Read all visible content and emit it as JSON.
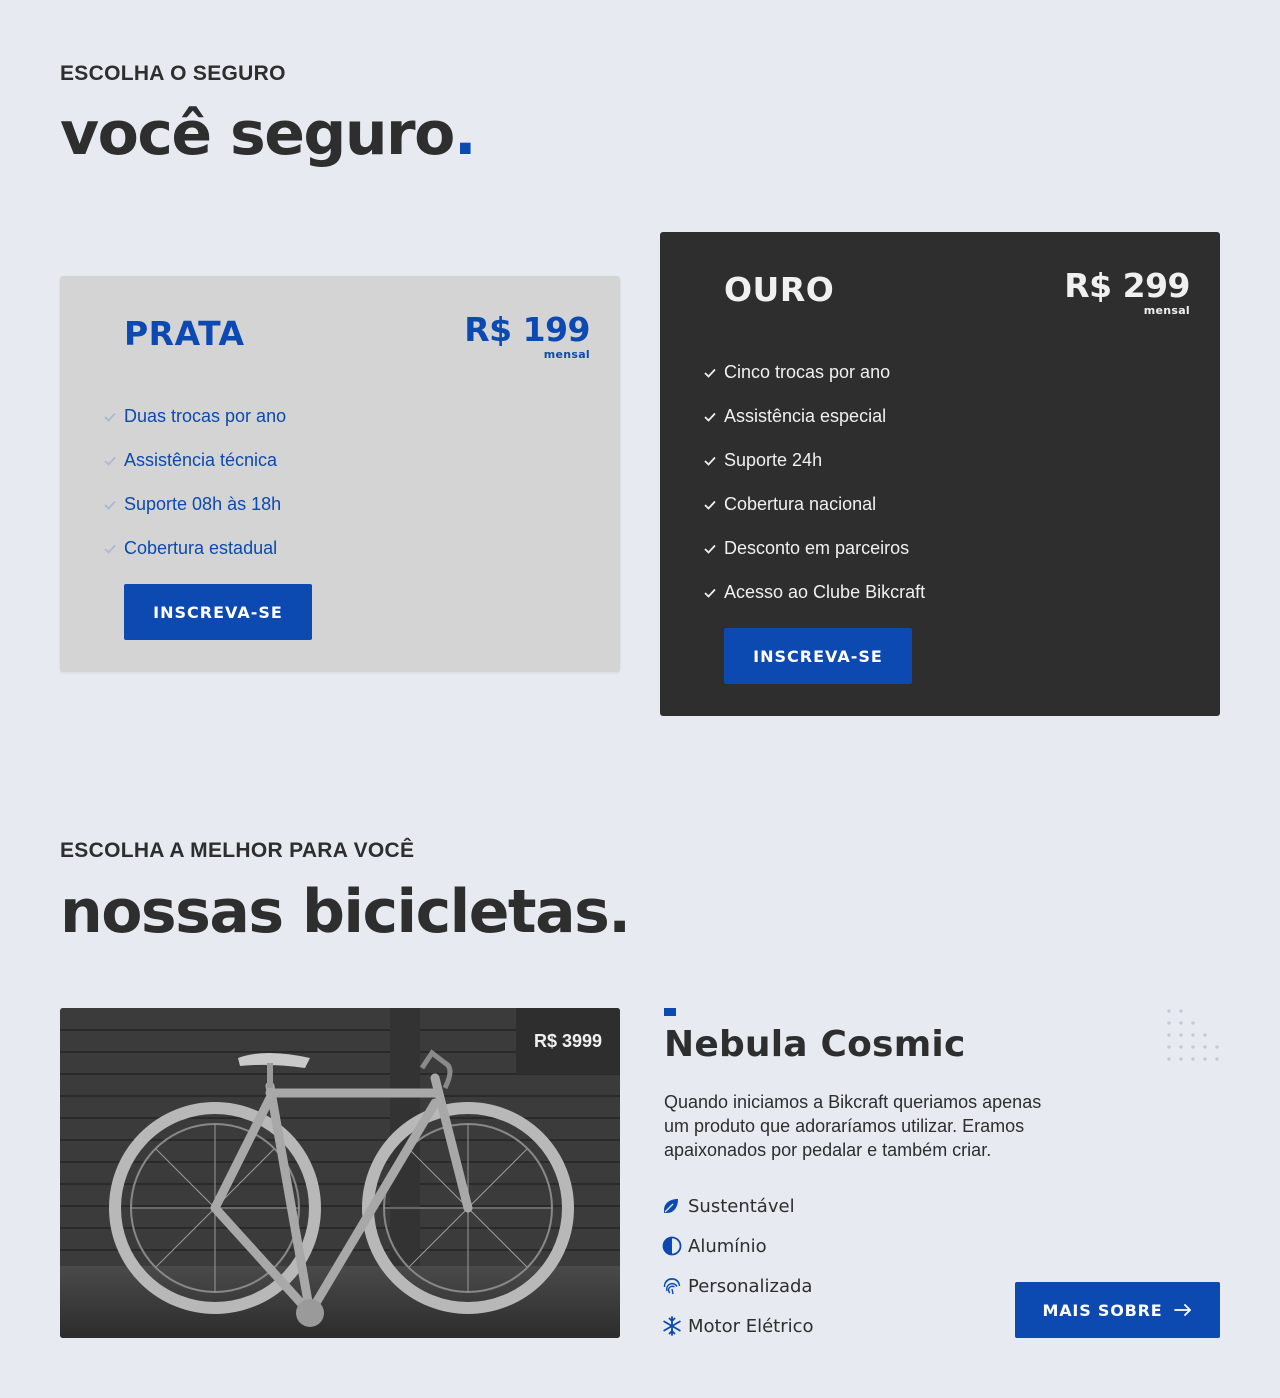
{
  "insurance": {
    "subtitle": "ESCOLHA O SEGURO",
    "title": "você seguro",
    "title_dot": "."
  },
  "plans": [
    {
      "name": "PRATA",
      "price": "R$ 199",
      "period": "mensal",
      "features": [
        "Duas trocas por ano",
        "Assistência técnica",
        "Suporte 08h às 18h",
        "Cobertura estadual"
      ],
      "button_label": "INSCREVA-SE"
    },
    {
      "name": "OURO",
      "price": "R$ 299",
      "period": "mensal",
      "features": [
        "Cinco trocas por ano",
        "Assistência especial",
        "Suporte 24h",
        "Cobertura nacional",
        "Desconto em parceiros",
        "Acesso ao Clube Bikcraft"
      ],
      "button_label": "INSCREVA-SE"
    }
  ],
  "bikes_section": {
    "subtitle": "ESCOLHA A MELHOR PARA VOCÊ",
    "title": "nossas bicicletas."
  },
  "bike": {
    "price": "R$ 3999",
    "name": "Nebula Cosmic",
    "description": "Quando iniciamos a Bikcraft queriamos apenas um produto que adoraríamos utilizar. Eramos apaixonados por pedalar e também criar.",
    "features": [
      {
        "icon": "leaf-icon",
        "label": "Sustentável"
      },
      {
        "icon": "half-circle-icon",
        "label": "Alumínio"
      },
      {
        "icon": "fingerprint-icon",
        "label": "Personalizada"
      },
      {
        "icon": "snowflake-icon",
        "label": "Motor Elétrico"
      }
    ],
    "button_label": "MAIS SOBRE",
    "button_icon": "arrow-right-icon"
  },
  "colors": {
    "accent": "#0c49b0",
    "background": "#e7eaf0",
    "dark": "#2e2e2e",
    "silver_card": "#d4d4d4"
  }
}
